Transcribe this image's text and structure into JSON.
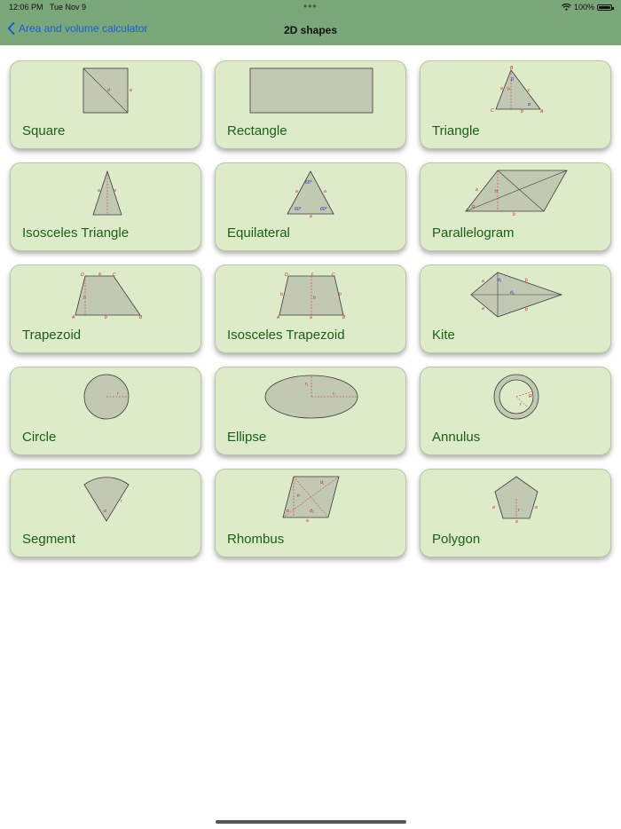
{
  "status_bar": {
    "time": "12:06 PM",
    "date": "Tue Nov 9",
    "battery": "100%"
  },
  "nav": {
    "back_label": "Area and volume calculator",
    "title": "2D shapes"
  },
  "shapes": [
    {
      "label": "Square",
      "icon": "square-icon"
    },
    {
      "label": "Rectangle",
      "icon": "rectangle-icon"
    },
    {
      "label": "Triangle",
      "icon": "triangle-icon"
    },
    {
      "label": "Isosceles Triangle",
      "icon": "isosceles-triangle-icon"
    },
    {
      "label": "Equilateral",
      "icon": "equilateral-icon"
    },
    {
      "label": "Parallelogram",
      "icon": "parallelogram-icon"
    },
    {
      "label": "Trapezoid",
      "icon": "trapezoid-icon"
    },
    {
      "label": "Isosceles Trapezoid",
      "icon": "isosceles-trapezoid-icon"
    },
    {
      "label": "Kite",
      "icon": "kite-icon"
    },
    {
      "label": "Circle",
      "icon": "circle-icon"
    },
    {
      "label": "Ellipse",
      "icon": "ellipse-icon"
    },
    {
      "label": "Annulus",
      "icon": "annulus-icon"
    },
    {
      "label": "Segment",
      "icon": "segment-icon"
    },
    {
      "label": "Rhombus",
      "icon": "rhombus-icon"
    },
    {
      "label": "Polygon",
      "icon": "polygon-icon"
    }
  ],
  "colors": {
    "nav_bar": "#79a779",
    "card_bg": "#ddebc9",
    "label_text": "#196019",
    "back_link": "#1a5fd4",
    "shape_fill": "#c2c9b3"
  }
}
